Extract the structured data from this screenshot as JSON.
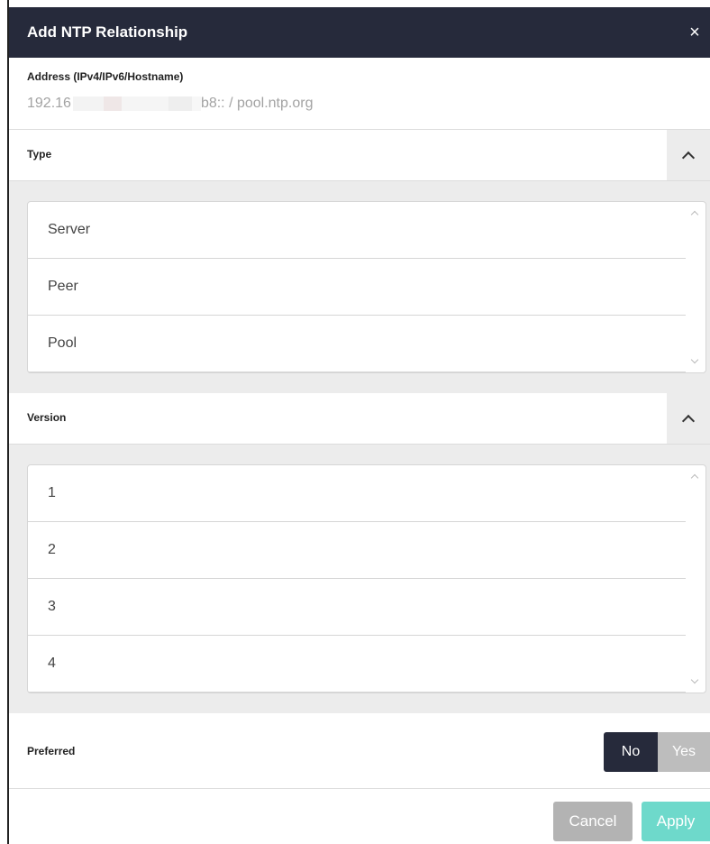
{
  "dialog": {
    "title": "Add NTP Relationship",
    "close_icon": "×"
  },
  "address": {
    "label": "Address (IPv4/IPv6/Hostname)",
    "placeholder_prefix": "192.16",
    "placeholder_suffix": "b8:: / pool.ntp.org"
  },
  "type": {
    "label": "Type",
    "options": [
      "Server",
      "Peer",
      "Pool"
    ]
  },
  "version": {
    "label": "Version",
    "options": [
      "1",
      "2",
      "3",
      "4"
    ]
  },
  "preferred": {
    "label": "Preferred",
    "no_label": "No",
    "yes_label": "Yes",
    "selected": "No"
  },
  "footer": {
    "cancel_label": "Cancel",
    "apply_label": "Apply"
  },
  "colors": {
    "header_bg": "#262a3b",
    "apply_bg": "#6ed9cb",
    "cancel_bg": "#b3b3b3"
  }
}
